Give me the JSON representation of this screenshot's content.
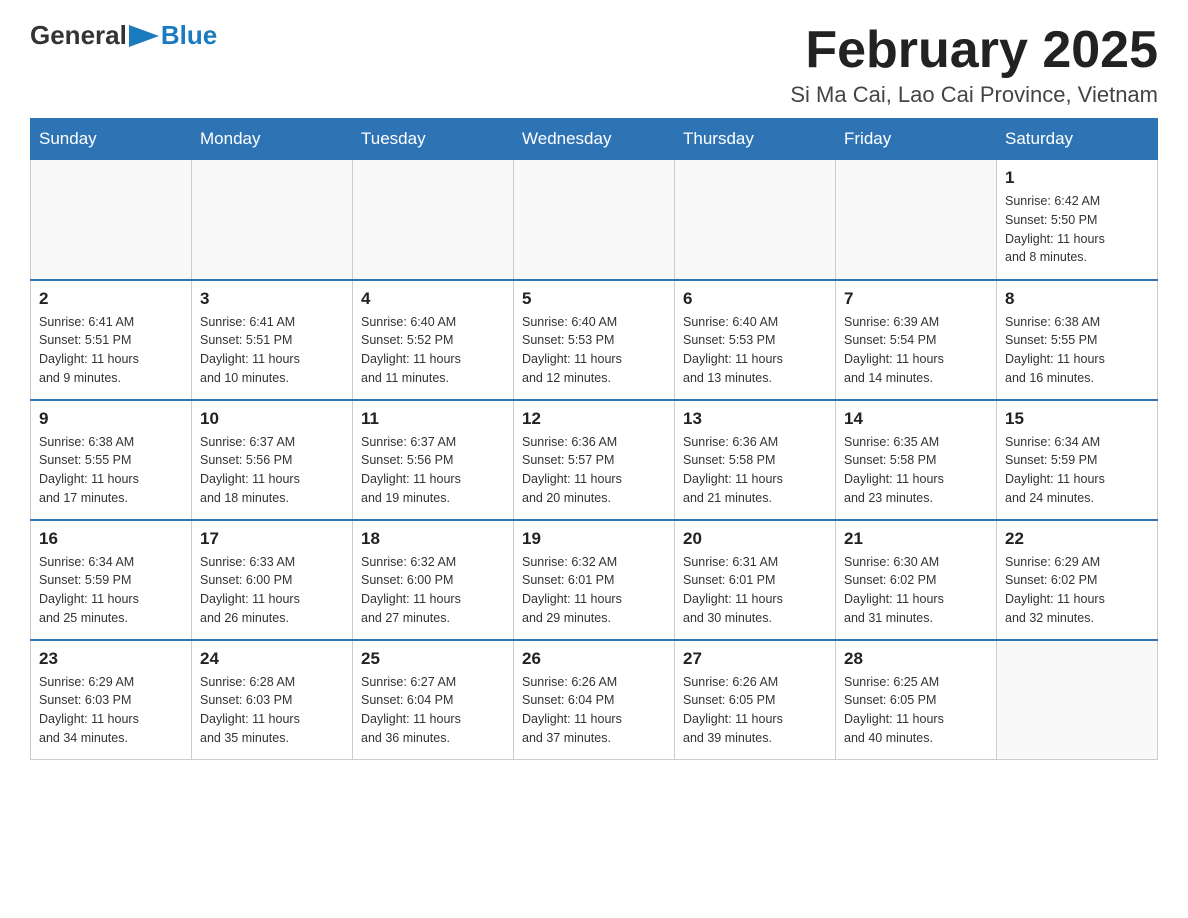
{
  "header": {
    "logo_general": "General",
    "logo_blue": "Blue",
    "title": "February 2025",
    "location": "Si Ma Cai, Lao Cai Province, Vietnam"
  },
  "days_of_week": [
    "Sunday",
    "Monday",
    "Tuesday",
    "Wednesday",
    "Thursday",
    "Friday",
    "Saturday"
  ],
  "weeks": [
    [
      {
        "day": "",
        "info": []
      },
      {
        "day": "",
        "info": []
      },
      {
        "day": "",
        "info": []
      },
      {
        "day": "",
        "info": []
      },
      {
        "day": "",
        "info": []
      },
      {
        "day": "",
        "info": []
      },
      {
        "day": "1",
        "info": [
          "Sunrise: 6:42 AM",
          "Sunset: 5:50 PM",
          "Daylight: 11 hours",
          "and 8 minutes."
        ]
      }
    ],
    [
      {
        "day": "2",
        "info": [
          "Sunrise: 6:41 AM",
          "Sunset: 5:51 PM",
          "Daylight: 11 hours",
          "and 9 minutes."
        ]
      },
      {
        "day": "3",
        "info": [
          "Sunrise: 6:41 AM",
          "Sunset: 5:51 PM",
          "Daylight: 11 hours",
          "and 10 minutes."
        ]
      },
      {
        "day": "4",
        "info": [
          "Sunrise: 6:40 AM",
          "Sunset: 5:52 PM",
          "Daylight: 11 hours",
          "and 11 minutes."
        ]
      },
      {
        "day": "5",
        "info": [
          "Sunrise: 6:40 AM",
          "Sunset: 5:53 PM",
          "Daylight: 11 hours",
          "and 12 minutes."
        ]
      },
      {
        "day": "6",
        "info": [
          "Sunrise: 6:40 AM",
          "Sunset: 5:53 PM",
          "Daylight: 11 hours",
          "and 13 minutes."
        ]
      },
      {
        "day": "7",
        "info": [
          "Sunrise: 6:39 AM",
          "Sunset: 5:54 PM",
          "Daylight: 11 hours",
          "and 14 minutes."
        ]
      },
      {
        "day": "8",
        "info": [
          "Sunrise: 6:38 AM",
          "Sunset: 5:55 PM",
          "Daylight: 11 hours",
          "and 16 minutes."
        ]
      }
    ],
    [
      {
        "day": "9",
        "info": [
          "Sunrise: 6:38 AM",
          "Sunset: 5:55 PM",
          "Daylight: 11 hours",
          "and 17 minutes."
        ]
      },
      {
        "day": "10",
        "info": [
          "Sunrise: 6:37 AM",
          "Sunset: 5:56 PM",
          "Daylight: 11 hours",
          "and 18 minutes."
        ]
      },
      {
        "day": "11",
        "info": [
          "Sunrise: 6:37 AM",
          "Sunset: 5:56 PM",
          "Daylight: 11 hours",
          "and 19 minutes."
        ]
      },
      {
        "day": "12",
        "info": [
          "Sunrise: 6:36 AM",
          "Sunset: 5:57 PM",
          "Daylight: 11 hours",
          "and 20 minutes."
        ]
      },
      {
        "day": "13",
        "info": [
          "Sunrise: 6:36 AM",
          "Sunset: 5:58 PM",
          "Daylight: 11 hours",
          "and 21 minutes."
        ]
      },
      {
        "day": "14",
        "info": [
          "Sunrise: 6:35 AM",
          "Sunset: 5:58 PM",
          "Daylight: 11 hours",
          "and 23 minutes."
        ]
      },
      {
        "day": "15",
        "info": [
          "Sunrise: 6:34 AM",
          "Sunset: 5:59 PM",
          "Daylight: 11 hours",
          "and 24 minutes."
        ]
      }
    ],
    [
      {
        "day": "16",
        "info": [
          "Sunrise: 6:34 AM",
          "Sunset: 5:59 PM",
          "Daylight: 11 hours",
          "and 25 minutes."
        ]
      },
      {
        "day": "17",
        "info": [
          "Sunrise: 6:33 AM",
          "Sunset: 6:00 PM",
          "Daylight: 11 hours",
          "and 26 minutes."
        ]
      },
      {
        "day": "18",
        "info": [
          "Sunrise: 6:32 AM",
          "Sunset: 6:00 PM",
          "Daylight: 11 hours",
          "and 27 minutes."
        ]
      },
      {
        "day": "19",
        "info": [
          "Sunrise: 6:32 AM",
          "Sunset: 6:01 PM",
          "Daylight: 11 hours",
          "and 29 minutes."
        ]
      },
      {
        "day": "20",
        "info": [
          "Sunrise: 6:31 AM",
          "Sunset: 6:01 PM",
          "Daylight: 11 hours",
          "and 30 minutes."
        ]
      },
      {
        "day": "21",
        "info": [
          "Sunrise: 6:30 AM",
          "Sunset: 6:02 PM",
          "Daylight: 11 hours",
          "and 31 minutes."
        ]
      },
      {
        "day": "22",
        "info": [
          "Sunrise: 6:29 AM",
          "Sunset: 6:02 PM",
          "Daylight: 11 hours",
          "and 32 minutes."
        ]
      }
    ],
    [
      {
        "day": "23",
        "info": [
          "Sunrise: 6:29 AM",
          "Sunset: 6:03 PM",
          "Daylight: 11 hours",
          "and 34 minutes."
        ]
      },
      {
        "day": "24",
        "info": [
          "Sunrise: 6:28 AM",
          "Sunset: 6:03 PM",
          "Daylight: 11 hours",
          "and 35 minutes."
        ]
      },
      {
        "day": "25",
        "info": [
          "Sunrise: 6:27 AM",
          "Sunset: 6:04 PM",
          "Daylight: 11 hours",
          "and 36 minutes."
        ]
      },
      {
        "day": "26",
        "info": [
          "Sunrise: 6:26 AM",
          "Sunset: 6:04 PM",
          "Daylight: 11 hours",
          "and 37 minutes."
        ]
      },
      {
        "day": "27",
        "info": [
          "Sunrise: 6:26 AM",
          "Sunset: 6:05 PM",
          "Daylight: 11 hours",
          "and 39 minutes."
        ]
      },
      {
        "day": "28",
        "info": [
          "Sunrise: 6:25 AM",
          "Sunset: 6:05 PM",
          "Daylight: 11 hours",
          "and 40 minutes."
        ]
      },
      {
        "day": "",
        "info": []
      }
    ]
  ],
  "colors": {
    "header_bg": "#2e74b5",
    "header_text": "#ffffff",
    "border": "#2e74b5"
  }
}
